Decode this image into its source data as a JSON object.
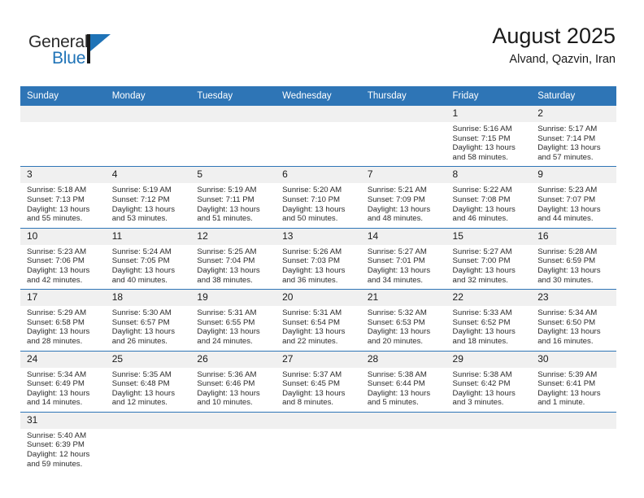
{
  "brand": {
    "name_part1": "General",
    "name_part2": "Blue",
    "accent_color": "#1f73b7"
  },
  "header": {
    "month_title": "August 2025",
    "location": "Alvand, Qazvin, Iran"
  },
  "calendar": {
    "header_color": "#2e75b6",
    "daynum_band_color": "#f0f0f0",
    "weekdays": [
      "Sunday",
      "Monday",
      "Tuesday",
      "Wednesday",
      "Thursday",
      "Friday",
      "Saturday"
    ],
    "weeks": [
      [
        {
          "day": "",
          "sunrise": "",
          "sunset": "",
          "daylight_line1": "",
          "daylight_line2": ""
        },
        {
          "day": "",
          "sunrise": "",
          "sunset": "",
          "daylight_line1": "",
          "daylight_line2": ""
        },
        {
          "day": "",
          "sunrise": "",
          "sunset": "",
          "daylight_line1": "",
          "daylight_line2": ""
        },
        {
          "day": "",
          "sunrise": "",
          "sunset": "",
          "daylight_line1": "",
          "daylight_line2": ""
        },
        {
          "day": "",
          "sunrise": "",
          "sunset": "",
          "daylight_line1": "",
          "daylight_line2": ""
        },
        {
          "day": "1",
          "sunrise": "Sunrise: 5:16 AM",
          "sunset": "Sunset: 7:15 PM",
          "daylight_line1": "Daylight: 13 hours",
          "daylight_line2": "and 58 minutes."
        },
        {
          "day": "2",
          "sunrise": "Sunrise: 5:17 AM",
          "sunset": "Sunset: 7:14 PM",
          "daylight_line1": "Daylight: 13 hours",
          "daylight_line2": "and 57 minutes."
        }
      ],
      [
        {
          "day": "3",
          "sunrise": "Sunrise: 5:18 AM",
          "sunset": "Sunset: 7:13 PM",
          "daylight_line1": "Daylight: 13 hours",
          "daylight_line2": "and 55 minutes."
        },
        {
          "day": "4",
          "sunrise": "Sunrise: 5:19 AM",
          "sunset": "Sunset: 7:12 PM",
          "daylight_line1": "Daylight: 13 hours",
          "daylight_line2": "and 53 minutes."
        },
        {
          "day": "5",
          "sunrise": "Sunrise: 5:19 AM",
          "sunset": "Sunset: 7:11 PM",
          "daylight_line1": "Daylight: 13 hours",
          "daylight_line2": "and 51 minutes."
        },
        {
          "day": "6",
          "sunrise": "Sunrise: 5:20 AM",
          "sunset": "Sunset: 7:10 PM",
          "daylight_line1": "Daylight: 13 hours",
          "daylight_line2": "and 50 minutes."
        },
        {
          "day": "7",
          "sunrise": "Sunrise: 5:21 AM",
          "sunset": "Sunset: 7:09 PM",
          "daylight_line1": "Daylight: 13 hours",
          "daylight_line2": "and 48 minutes."
        },
        {
          "day": "8",
          "sunrise": "Sunrise: 5:22 AM",
          "sunset": "Sunset: 7:08 PM",
          "daylight_line1": "Daylight: 13 hours",
          "daylight_line2": "and 46 minutes."
        },
        {
          "day": "9",
          "sunrise": "Sunrise: 5:23 AM",
          "sunset": "Sunset: 7:07 PM",
          "daylight_line1": "Daylight: 13 hours",
          "daylight_line2": "and 44 minutes."
        }
      ],
      [
        {
          "day": "10",
          "sunrise": "Sunrise: 5:23 AM",
          "sunset": "Sunset: 7:06 PM",
          "daylight_line1": "Daylight: 13 hours",
          "daylight_line2": "and 42 minutes."
        },
        {
          "day": "11",
          "sunrise": "Sunrise: 5:24 AM",
          "sunset": "Sunset: 7:05 PM",
          "daylight_line1": "Daylight: 13 hours",
          "daylight_line2": "and 40 minutes."
        },
        {
          "day": "12",
          "sunrise": "Sunrise: 5:25 AM",
          "sunset": "Sunset: 7:04 PM",
          "daylight_line1": "Daylight: 13 hours",
          "daylight_line2": "and 38 minutes."
        },
        {
          "day": "13",
          "sunrise": "Sunrise: 5:26 AM",
          "sunset": "Sunset: 7:03 PM",
          "daylight_line1": "Daylight: 13 hours",
          "daylight_line2": "and 36 minutes."
        },
        {
          "day": "14",
          "sunrise": "Sunrise: 5:27 AM",
          "sunset": "Sunset: 7:01 PM",
          "daylight_line1": "Daylight: 13 hours",
          "daylight_line2": "and 34 minutes."
        },
        {
          "day": "15",
          "sunrise": "Sunrise: 5:27 AM",
          "sunset": "Sunset: 7:00 PM",
          "daylight_line1": "Daylight: 13 hours",
          "daylight_line2": "and 32 minutes."
        },
        {
          "day": "16",
          "sunrise": "Sunrise: 5:28 AM",
          "sunset": "Sunset: 6:59 PM",
          "daylight_line1": "Daylight: 13 hours",
          "daylight_line2": "and 30 minutes."
        }
      ],
      [
        {
          "day": "17",
          "sunrise": "Sunrise: 5:29 AM",
          "sunset": "Sunset: 6:58 PM",
          "daylight_line1": "Daylight: 13 hours",
          "daylight_line2": "and 28 minutes."
        },
        {
          "day": "18",
          "sunrise": "Sunrise: 5:30 AM",
          "sunset": "Sunset: 6:57 PM",
          "daylight_line1": "Daylight: 13 hours",
          "daylight_line2": "and 26 minutes."
        },
        {
          "day": "19",
          "sunrise": "Sunrise: 5:31 AM",
          "sunset": "Sunset: 6:55 PM",
          "daylight_line1": "Daylight: 13 hours",
          "daylight_line2": "and 24 minutes."
        },
        {
          "day": "20",
          "sunrise": "Sunrise: 5:31 AM",
          "sunset": "Sunset: 6:54 PM",
          "daylight_line1": "Daylight: 13 hours",
          "daylight_line2": "and 22 minutes."
        },
        {
          "day": "21",
          "sunrise": "Sunrise: 5:32 AM",
          "sunset": "Sunset: 6:53 PM",
          "daylight_line1": "Daylight: 13 hours",
          "daylight_line2": "and 20 minutes."
        },
        {
          "day": "22",
          "sunrise": "Sunrise: 5:33 AM",
          "sunset": "Sunset: 6:52 PM",
          "daylight_line1": "Daylight: 13 hours",
          "daylight_line2": "and 18 minutes."
        },
        {
          "day": "23",
          "sunrise": "Sunrise: 5:34 AM",
          "sunset": "Sunset: 6:50 PM",
          "daylight_line1": "Daylight: 13 hours",
          "daylight_line2": "and 16 minutes."
        }
      ],
      [
        {
          "day": "24",
          "sunrise": "Sunrise: 5:34 AM",
          "sunset": "Sunset: 6:49 PM",
          "daylight_line1": "Daylight: 13 hours",
          "daylight_line2": "and 14 minutes."
        },
        {
          "day": "25",
          "sunrise": "Sunrise: 5:35 AM",
          "sunset": "Sunset: 6:48 PM",
          "daylight_line1": "Daylight: 13 hours",
          "daylight_line2": "and 12 minutes."
        },
        {
          "day": "26",
          "sunrise": "Sunrise: 5:36 AM",
          "sunset": "Sunset: 6:46 PM",
          "daylight_line1": "Daylight: 13 hours",
          "daylight_line2": "and 10 minutes."
        },
        {
          "day": "27",
          "sunrise": "Sunrise: 5:37 AM",
          "sunset": "Sunset: 6:45 PM",
          "daylight_line1": "Daylight: 13 hours",
          "daylight_line2": "and 8 minutes."
        },
        {
          "day": "28",
          "sunrise": "Sunrise: 5:38 AM",
          "sunset": "Sunset: 6:44 PM",
          "daylight_line1": "Daylight: 13 hours",
          "daylight_line2": "and 5 minutes."
        },
        {
          "day": "29",
          "sunrise": "Sunrise: 5:38 AM",
          "sunset": "Sunset: 6:42 PM",
          "daylight_line1": "Daylight: 13 hours",
          "daylight_line2": "and 3 minutes."
        },
        {
          "day": "30",
          "sunrise": "Sunrise: 5:39 AM",
          "sunset": "Sunset: 6:41 PM",
          "daylight_line1": "Daylight: 13 hours",
          "daylight_line2": "and 1 minute."
        }
      ],
      [
        {
          "day": "31",
          "sunrise": "Sunrise: 5:40 AM",
          "sunset": "Sunset: 6:39 PM",
          "daylight_line1": "Daylight: 12 hours",
          "daylight_line2": "and 59 minutes."
        },
        {
          "day": "",
          "sunrise": "",
          "sunset": "",
          "daylight_line1": "",
          "daylight_line2": ""
        },
        {
          "day": "",
          "sunrise": "",
          "sunset": "",
          "daylight_line1": "",
          "daylight_line2": ""
        },
        {
          "day": "",
          "sunrise": "",
          "sunset": "",
          "daylight_line1": "",
          "daylight_line2": ""
        },
        {
          "day": "",
          "sunrise": "",
          "sunset": "",
          "daylight_line1": "",
          "daylight_line2": ""
        },
        {
          "day": "",
          "sunrise": "",
          "sunset": "",
          "daylight_line1": "",
          "daylight_line2": ""
        },
        {
          "day": "",
          "sunrise": "",
          "sunset": "",
          "daylight_line1": "",
          "daylight_line2": ""
        }
      ]
    ]
  }
}
